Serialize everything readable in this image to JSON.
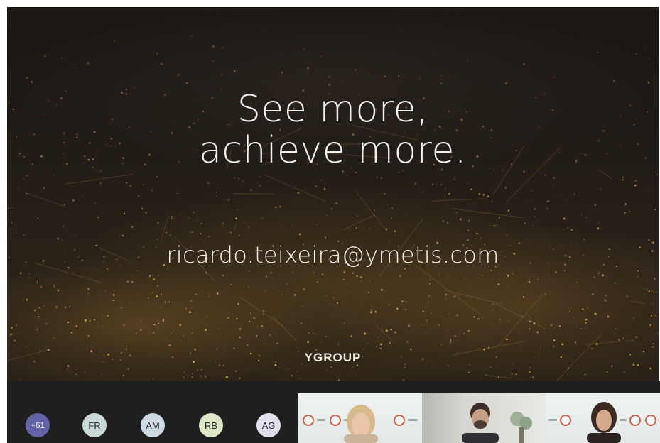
{
  "slide": {
    "headline_line1": "See more,",
    "headline_line2": "achieve more.",
    "email": "ricardo.teixeira@ymetis.com",
    "brand": "YGROUP"
  },
  "participants": {
    "overflow_count": "+61",
    "avatars": [
      {
        "initials": "FR"
      },
      {
        "initials": "AM"
      },
      {
        "initials": "RB"
      },
      {
        "initials": "AG"
      }
    ]
  },
  "colors": {
    "overflow_badge": "#6264a7",
    "strip_background": "#1f1f1f",
    "logo_accent": "#d65a45"
  }
}
